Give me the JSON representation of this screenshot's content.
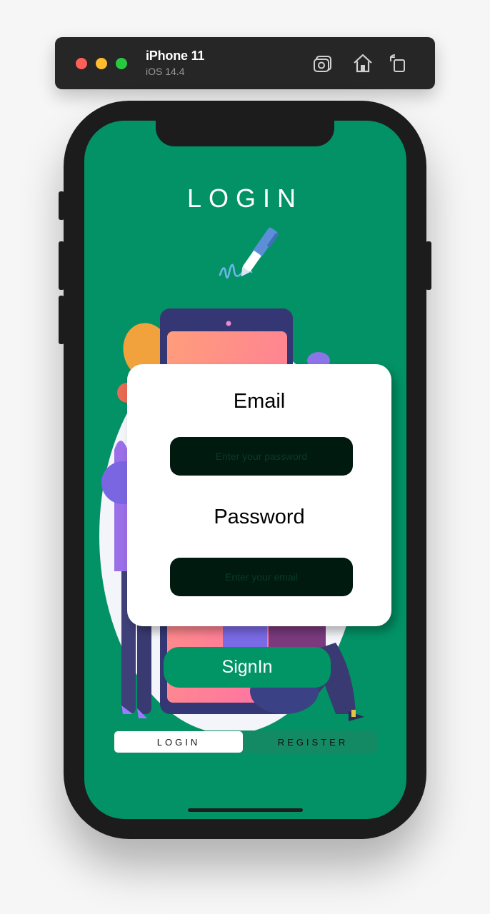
{
  "simulator": {
    "device": "iPhone 11",
    "os": "iOS 14.4",
    "traffic_lights": [
      "#fe5f57",
      "#febc2e",
      "#28c840"
    ],
    "tools": [
      "screenshot-icon",
      "home-icon",
      "rotate-icon"
    ]
  },
  "app": {
    "title": "LOGIN",
    "background": "#029265",
    "email": {
      "label": "Email",
      "placeholder": "Enter your password"
    },
    "password": {
      "label": "Password",
      "placeholder": "Enter your email"
    },
    "signin_label": "SignIn",
    "tabs": [
      {
        "label": "LOGIN",
        "active": true
      },
      {
        "label": "REGISTER",
        "active": false
      }
    ]
  }
}
